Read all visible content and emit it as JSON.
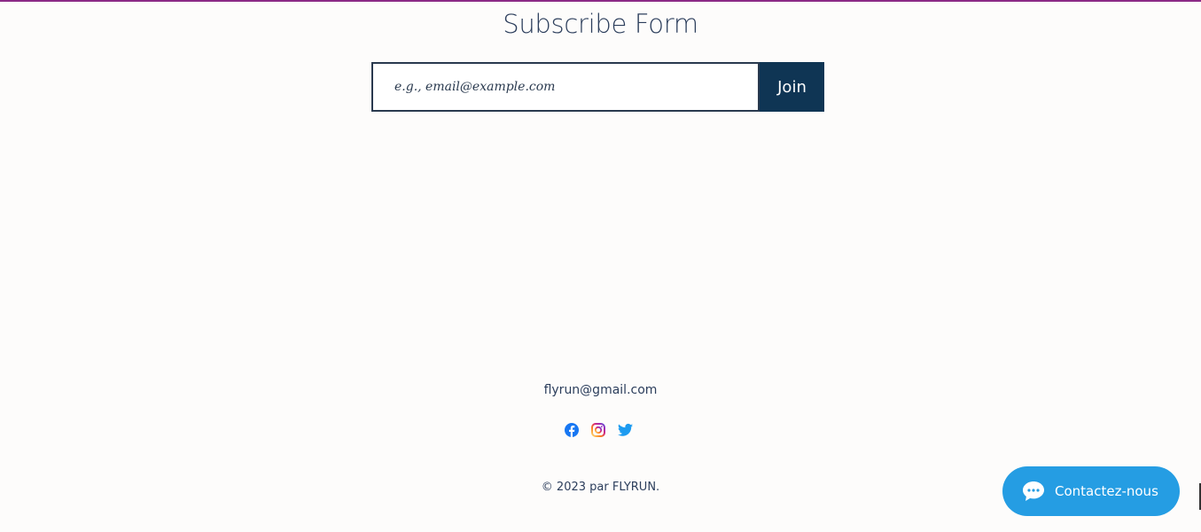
{
  "form": {
    "title": "Subscribe Form",
    "email_placeholder": "e.g., email@example.com",
    "join_label": "Join"
  },
  "footer": {
    "email": "flyrun@gmail.com",
    "social_icons": [
      "facebook-icon",
      "instagram-icon",
      "twitter-icon"
    ],
    "copyright": "© 2023 par FLYRUN."
  },
  "chat_widget": {
    "label": "Contactez-nous",
    "icon": "chat-bubble-icon"
  },
  "colors": {
    "top_border": "#8b2a86",
    "primary_button": "#0f3554",
    "chat_button": "#259de3",
    "text": "#2c3e5c",
    "facebook": "#1877f2",
    "twitter": "#1d9bf0"
  }
}
